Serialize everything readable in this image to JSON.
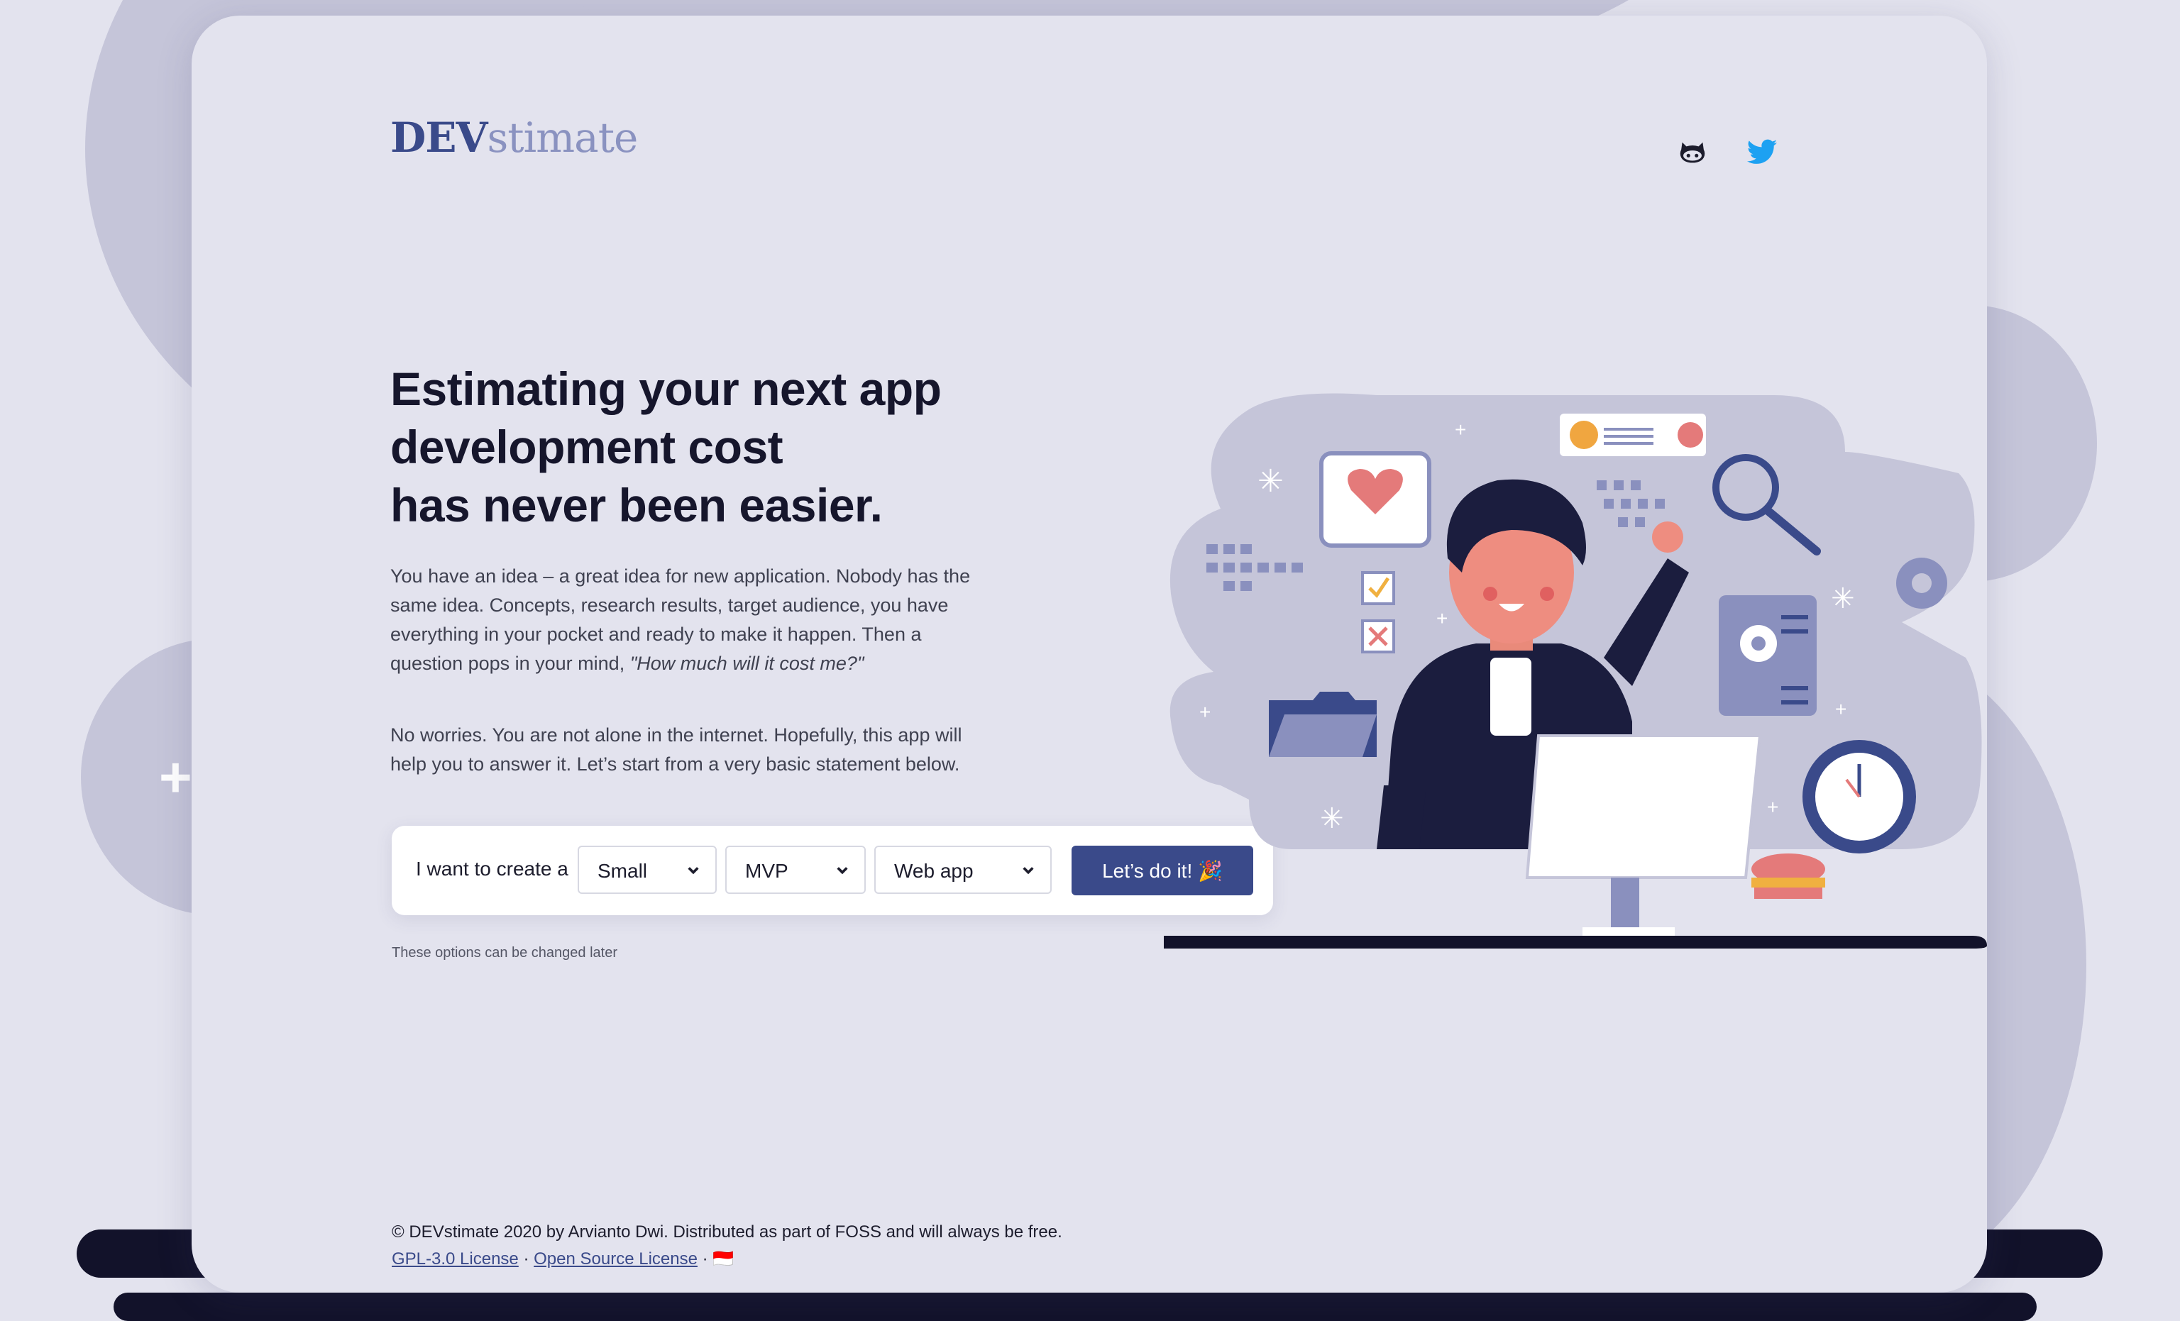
{
  "brand": {
    "logo_bold": "DEV",
    "logo_light": "stimate"
  },
  "social": [
    {
      "name": "GitHub",
      "icon": "github-icon"
    },
    {
      "name": "Twitter",
      "icon": "twitter-icon"
    }
  ],
  "hero": {
    "headline_line1": "Estimating your next app",
    "headline_line2": "development cost",
    "headline_line3": "has never been easier.",
    "paragraph1_text": "You have an idea – a great idea for new application. Nobody has the same idea. Concepts, research results, target audience, you have everything in your pocket and ready to make it happen. Then a question pops in your mind, ",
    "paragraph1_quote": "\"How much will it cost me?\"",
    "paragraph2": "No worries. You are not alone in the internet. Hopefully, this app will help you to answer it. Let’s start from a very basic statement below."
  },
  "form": {
    "label": "I want to create a",
    "size_select": "Small",
    "stage_select": "MVP",
    "platform_select": "Web app",
    "submit_label": "Let’s do it! 🎉",
    "hint": "These options can be changed later"
  },
  "footer": {
    "copyright": "© DEVstimate 2020 by Arvianto Dwi. Distributed as part of FOSS and will always be free.",
    "link1": "GPL-3.0 License",
    "separator": "·",
    "link2": "Open Source License",
    "flag": "🇮🇩"
  },
  "colors": {
    "primary": "#3a4a8a",
    "brand_light": "#8a92c0",
    "background": "#e3e3ee",
    "dark": "#12122a",
    "twitter": "#1da1f2"
  }
}
